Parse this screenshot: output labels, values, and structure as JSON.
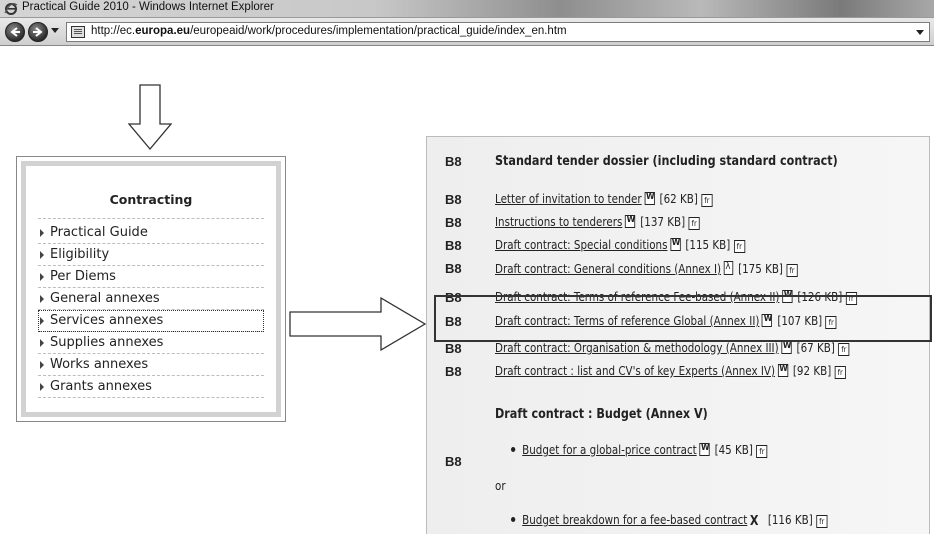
{
  "browser": {
    "window_title": "Practical Guide 2010 - Windows Internet Explorer",
    "url_prefix": "http://ec.",
    "url_bold": "europa.eu",
    "url_suffix": "/europeaid/work/procedures/implementation/practical_guide/index_en.htm"
  },
  "menu": {
    "heading": "Contracting",
    "items": [
      {
        "label": "Practical Guide"
      },
      {
        "label": "Eligibility"
      },
      {
        "label": "Per Diems"
      },
      {
        "label": "General annexes"
      },
      {
        "label": "Services annexes",
        "selected": true
      },
      {
        "label": "Supplies annexes"
      },
      {
        "label": "Works annexes"
      },
      {
        "label": "Grants annexes"
      }
    ]
  },
  "document": {
    "header": {
      "code": "B8",
      "title": "Standard tender dossier (including standard contract)"
    },
    "rows": [
      {
        "code": "B8",
        "link": "Letter of invitation to tender",
        "icon": "word-icon",
        "size": "[62 KB]",
        "lang": "fr"
      },
      {
        "code": "B8",
        "link": "Instructions to tenderers",
        "icon": "word-icon",
        "size": "[137 KB]",
        "lang": "fr"
      },
      {
        "code": "B8",
        "link": "Draft contract: Special conditions",
        "icon": "word-icon",
        "size": "[115 KB]",
        "lang": "fr"
      },
      {
        "code": "B8",
        "link": "Draft contract: General conditions (Annex I)",
        "icon": "pdf-icon",
        "size": "[175 KB]",
        "lang": "fr"
      },
      {
        "code": "B8",
        "link": "Draft contract: Terms of reference Fee-based (Annex II)",
        "icon": "word-icon",
        "size": "[126 KB]",
        "lang": "fr"
      },
      {
        "code": "B8",
        "link": "Draft contract: Terms of reference Global (Annex II)",
        "icon": "word-icon",
        "size": "[107 KB]",
        "lang": "fr"
      },
      {
        "code": "B8",
        "link": "Draft contract: Organisation & methodology (Annex III)",
        "icon": "word-icon",
        "size": "[67 KB]",
        "lang": "fr"
      },
      {
        "code": "B8",
        "link": "Draft contract : list and CV's of key Experts (Annex IV)",
        "icon": "word-icon",
        "size": "[92 KB]",
        "lang": "fr"
      }
    ],
    "budget": {
      "title": "Draft contract : Budget (Annex V)",
      "code": "B8",
      "item1": {
        "link": "Budget for a global-price contract",
        "icon": "word-icon",
        "size": "[45 KB]",
        "lang": "fr"
      },
      "or_text": "or",
      "item2": {
        "link": "Budget breakdown for a fee-based contract",
        "icon": "excel-icon",
        "size": "[116 KB]",
        "lang": "fr"
      }
    }
  }
}
